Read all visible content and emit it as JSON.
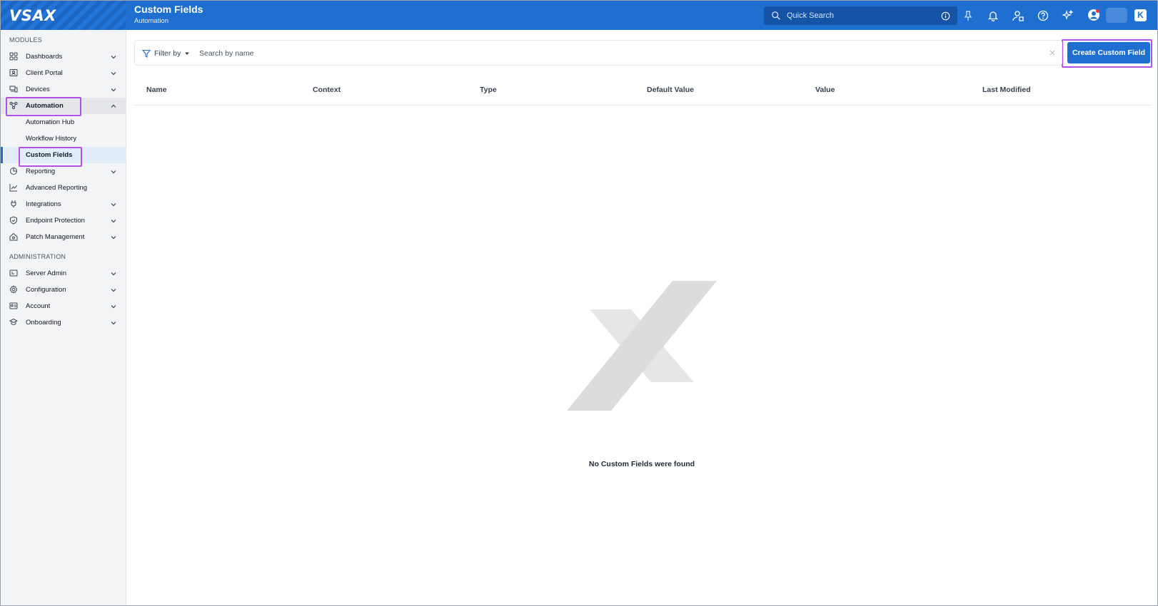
{
  "header": {
    "logo": "VSAX",
    "title": "Custom Fields",
    "subtitle": "Automation",
    "search_placeholder": "Quick Search",
    "user_initial": "K",
    "accent": "#1f6fd1"
  },
  "sidebar": {
    "modules_label": "MODULES",
    "admin_label": "ADMINISTRATION",
    "items": [
      {
        "label": "Dashboards",
        "icon": "dashboard-icon"
      },
      {
        "label": "Client Portal",
        "icon": "portal-icon"
      },
      {
        "label": "Devices",
        "icon": "devices-icon"
      },
      {
        "label": "Automation",
        "icon": "automation-icon"
      },
      {
        "label": "Reporting",
        "icon": "reporting-icon"
      },
      {
        "label": "Advanced Reporting",
        "icon": "chart-icon"
      },
      {
        "label": "Integrations",
        "icon": "plug-icon"
      },
      {
        "label": "Endpoint Protection",
        "icon": "shield-icon"
      },
      {
        "label": "Patch Management",
        "icon": "patch-icon"
      }
    ],
    "automation_sub": [
      "Automation Hub",
      "Workflow History",
      "Custom Fields"
    ],
    "admin_items": [
      {
        "label": "Server Admin",
        "icon": "server-icon"
      },
      {
        "label": "Configuration",
        "icon": "gear-icon"
      },
      {
        "label": "Account",
        "icon": "account-icon"
      },
      {
        "label": "Onboarding",
        "icon": "onboarding-icon"
      }
    ]
  },
  "toolbar": {
    "filter_label": "Filter by",
    "search_placeholder": "Search by name",
    "create_label": "Create Custom Field"
  },
  "table": {
    "columns": [
      "Name",
      "Context",
      "Type",
      "Default Value",
      "Value",
      "Last Modified"
    ]
  },
  "empty_state": {
    "message": "No Custom Fields were found"
  }
}
